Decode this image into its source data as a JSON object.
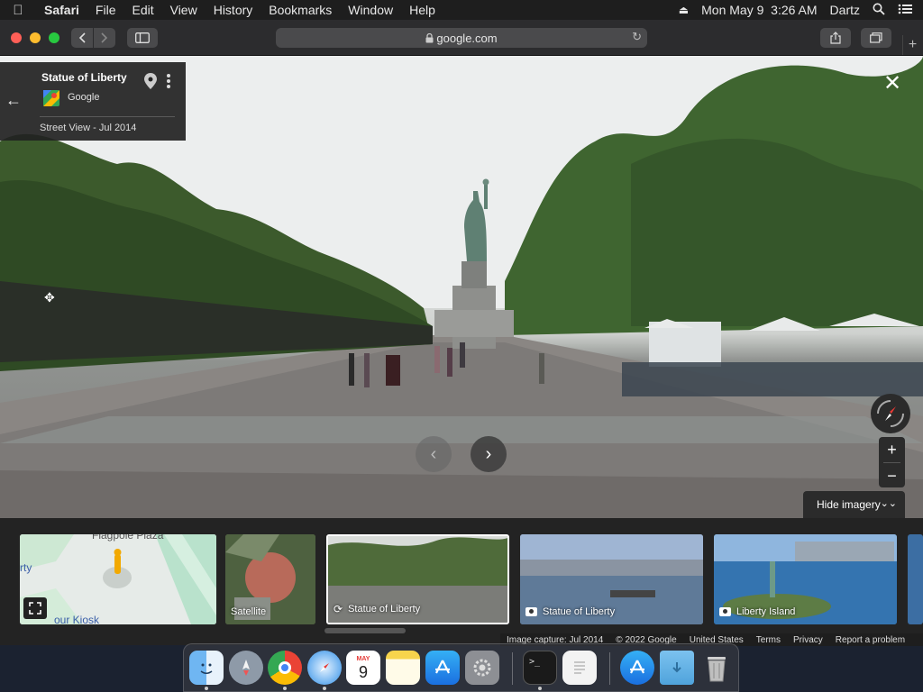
{
  "menubar": {
    "app": "Safari",
    "items": [
      "File",
      "Edit",
      "View",
      "History",
      "Bookmarks",
      "Window",
      "Help"
    ],
    "datetime": "Mon May 9  3:26 AM",
    "user": "Dartz"
  },
  "browser": {
    "url": "google.com"
  },
  "streetview": {
    "place_title": "Statue of Liberty",
    "provider": "Google",
    "capture_label": "Street View - Jul 2014",
    "hide_imagery_label": "Hide imagery"
  },
  "map_thumb": {
    "label_top": "Flagpole Plaza",
    "label_left": "rty",
    "label_bottom": "our Kiosk"
  },
  "filmstrip": [
    {
      "label": "Satellite",
      "icon": ""
    },
    {
      "label": "Statue of Liberty",
      "icon": "360-icon"
    },
    {
      "label": "Statue of Liberty",
      "icon": "camera-icon"
    },
    {
      "label": "Liberty Island",
      "icon": "camera-icon"
    }
  ],
  "footer": {
    "image_capture": "Image capture: Jul 2014",
    "copyright": "© 2022 Google",
    "country": "United States",
    "terms": "Terms",
    "privacy": "Privacy",
    "report": "Report a problem"
  },
  "dock": {
    "calendar_month": "MAY",
    "calendar_day": "9",
    "apps": [
      "finder-icon",
      "launchpad-icon",
      "chrome-icon",
      "safari-icon",
      "calendar-icon",
      "notes-icon",
      "app-store-icon",
      "system-preferences-icon",
      "terminal-icon",
      "textedit-icon",
      "app-store-alt-icon",
      "downloads-folder-icon",
      "trash-icon"
    ]
  },
  "colors": {
    "menubar_bg": "#1e1e1e",
    "toolbar_bg": "#2c2c2e",
    "panel_bg": "#222222",
    "filmstrip_bg": "#232323",
    "selected_border": "#ffffff"
  }
}
